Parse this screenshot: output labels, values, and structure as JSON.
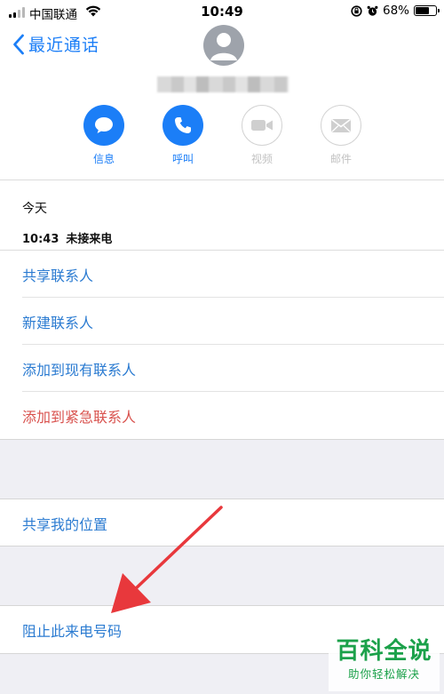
{
  "status_bar": {
    "carrier": "中国联通",
    "time": "10:49",
    "battery": "68%",
    "signal_bars": 2
  },
  "header": {
    "back_label": "最近通话"
  },
  "actions": [
    {
      "label": "信息",
      "icon": "message-icon",
      "enabled": true
    },
    {
      "label": "呼叫",
      "icon": "phone-icon",
      "enabled": true
    },
    {
      "label": "视频",
      "icon": "video-icon",
      "enabled": false
    },
    {
      "label": "邮件",
      "icon": "mail-icon",
      "enabled": false
    }
  ],
  "call_history": {
    "day": "今天",
    "time": "10:43",
    "status": "未接来电"
  },
  "menu": {
    "share_contact": "共享联系人",
    "new_contact": "新建联系人",
    "add_existing": "添加到现有联系人",
    "add_emergency": "添加到紧急联系人",
    "share_location": "共享我的位置",
    "block_caller": "阻止此来电号码"
  },
  "watermark": {
    "title": "百科全说",
    "subtitle": "助你轻松解决"
  },
  "colors": {
    "accent": "#1b7ef7",
    "link": "#2b7bd1",
    "danger": "#d9534f",
    "watermark": "#1ba14a",
    "arrow": "#e8383c"
  }
}
